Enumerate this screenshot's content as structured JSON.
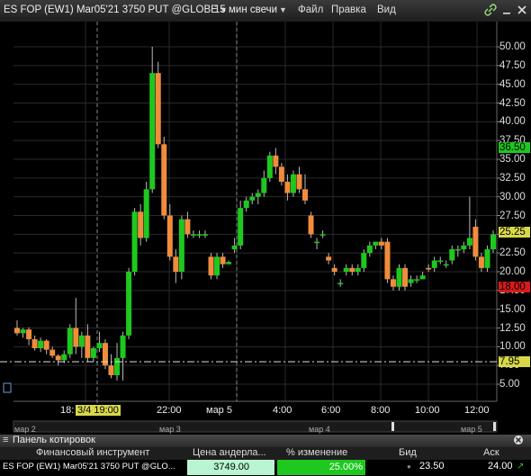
{
  "window": {
    "title": "ES FOP (EW1) Mar05'21 3750 PUT @GLOBE",
    "interval": "15 мин свечи",
    "menu": [
      "Файл",
      "Правка",
      "Вид"
    ]
  },
  "price_axis": [
    "50.00",
    "47.50",
    "45.00",
    "42.50",
    "40.00",
    "37.50",
    "35.00",
    "32.50",
    "30.00",
    "27.50",
    "25.00",
    "22.50",
    "20.00",
    "17.50",
    "15.00",
    "12.50",
    "10.00",
    "7.50",
    "5.00"
  ],
  "price_tags": {
    "ask": "36.50",
    "last": "25.25",
    "bid": "18.00",
    "crosshair": "7.95"
  },
  "time_axis": {
    "labels": [
      "18:",
      "22:00",
      "мар 5",
      "4:00",
      "6:00",
      "8:00",
      "10:00",
      "12:00"
    ],
    "crosshair_time": "3/4 19:00",
    "day_labels": [
      "мар 2",
      "мар 3",
      "мар 4",
      "мар 5"
    ]
  },
  "quote_panel": {
    "title": "Панель котировок",
    "columns": [
      "Финансовый инструмент",
      "Цена андерла...",
      "% изменение",
      "Бид",
      "Аск"
    ],
    "row": {
      "instrument": "ES FOP (EW1) Mar05'21 3750 PUT @GLO...",
      "underlying": "3749.00",
      "change": "25.00%",
      "bid": "23.50",
      "ask": "24.00"
    }
  },
  "colors": {
    "up": "#1ec81e",
    "down": "#f08c3c",
    "bid_tag": "#d81a1a",
    "ask_tag": "#1ec81e",
    "last_tag": "#d8d84a",
    "crosshair_tag": "#d8d84a",
    "change_bg": "#1ec81e",
    "underlying_bg": "#b9f5d2"
  },
  "chart_data": {
    "type": "candlestick",
    "ylim": [
      3.5,
      52.5
    ],
    "candles": [
      {
        "o": 12.5,
        "h": 13.5,
        "l": 11.5,
        "c": 11.8
      },
      {
        "o": 11.8,
        "h": 12.5,
        "l": 11.2,
        "c": 12.3
      },
      {
        "o": 12.3,
        "h": 12.6,
        "l": 10.2,
        "c": 11.0
      },
      {
        "o": 11.0,
        "h": 11.5,
        "l": 9.5,
        "c": 9.8
      },
      {
        "o": 9.8,
        "h": 11.2,
        "l": 9.3,
        "c": 10.8
      },
      {
        "o": 10.8,
        "h": 11.0,
        "l": 9.0,
        "c": 9.6
      },
      {
        "o": 9.6,
        "h": 10.0,
        "l": 8.5,
        "c": 8.8
      },
      {
        "o": 8.8,
        "h": 9.0,
        "l": 7.5,
        "c": 8.2
      },
      {
        "o": 8.2,
        "h": 9.5,
        "l": 7.8,
        "c": 9.0
      },
      {
        "o": 9.0,
        "h": 13.0,
        "l": 8.5,
        "c": 12.5
      },
      {
        "o": 12.5,
        "h": 16.5,
        "l": 9.0,
        "c": 10.0
      },
      {
        "o": 10.0,
        "h": 12.0,
        "l": 8.5,
        "c": 11.5
      },
      {
        "o": 11.5,
        "h": 13.0,
        "l": 8.0,
        "c": 8.5
      },
      {
        "o": 8.5,
        "h": 10.0,
        "l": 8.0,
        "c": 9.8
      },
      {
        "o": 9.8,
        "h": 12.0,
        "l": 9.3,
        "c": 10.5
      },
      {
        "o": 10.5,
        "h": 11.0,
        "l": 7.0,
        "c": 7.5
      },
      {
        "o": 7.5,
        "h": 9.0,
        "l": 5.8,
        "c": 6.2
      },
      {
        "o": 6.2,
        "h": 10.5,
        "l": 5.5,
        "c": 8.5
      },
      {
        "o": 8.5,
        "h": 12.0,
        "l": 5.5,
        "c": 11.5
      },
      {
        "o": 11.5,
        "h": 20.5,
        "l": 11.0,
        "c": 20.0
      },
      {
        "o": 20.0,
        "h": 28.5,
        "l": 19.5,
        "c": 28.0
      },
      {
        "o": 28.0,
        "h": 29.0,
        "l": 23.5,
        "c": 24.5
      },
      {
        "o": 24.5,
        "h": 32.0,
        "l": 24.0,
        "c": 31.0
      },
      {
        "o": 31.0,
        "h": 50.0,
        "l": 30.5,
        "c": 46.5
      },
      {
        "o": 46.5,
        "h": 48.0,
        "l": 36.5,
        "c": 37.0
      },
      {
        "o": 37.0,
        "h": 38.0,
        "l": 27.0,
        "c": 27.5
      },
      {
        "o": 27.5,
        "h": 29.0,
        "l": 21.5,
        "c": 22.0
      },
      {
        "o": 22.0,
        "h": 23.0,
        "l": 18.5,
        "c": 20.0
      },
      {
        "o": 20.0,
        "h": 27.5,
        "l": 19.0,
        "c": 27.0
      },
      {
        "o": 27.0,
        "h": 28.0,
        "l": 24.5,
        "c": 25.0
      },
      {
        "o": 25.0,
        "h": 25.5,
        "l": 24.5,
        "c": 25.0
      },
      {
        "o": 25.0,
        "h": 25.5,
        "l": 24.5,
        "c": 25.0
      },
      {
        "o": 25.0,
        "h": 25.5,
        "l": 24.5,
        "c": 25.0
      },
      {
        "o": 22.0,
        "h": 22.5,
        "l": 19.0,
        "c": 19.5
      },
      {
        "o": 19.5,
        "h": 22.5,
        "l": 19.0,
        "c": 22.0
      },
      {
        "o": 22.0,
        "h": 22.5,
        "l": 20.5,
        "c": 21.0
      },
      {
        "o": 21.0,
        "h": 21.5,
        "l": 21.0,
        "c": 21.3
      },
      {
        "o": 23.0,
        "h": 24.5,
        "l": 22.5,
        "c": 23.5
      },
      {
        "o": 23.5,
        "h": 29.5,
        "l": 23.0,
        "c": 28.5
      },
      {
        "o": 28.5,
        "h": 30.0,
        "l": 28.0,
        "c": 29.5
      },
      {
        "o": 29.5,
        "h": 30.5,
        "l": 29.0,
        "c": 30.0
      },
      {
        "o": 30.0,
        "h": 31.0,
        "l": 29.0,
        "c": 30.5
      },
      {
        "o": 30.5,
        "h": 33.5,
        "l": 30.0,
        "c": 32.5
      },
      {
        "o": 32.5,
        "h": 36.0,
        "l": 32.0,
        "c": 35.5
      },
      {
        "o": 35.5,
        "h": 36.5,
        "l": 33.0,
        "c": 34.0
      },
      {
        "o": 34.0,
        "h": 34.5,
        "l": 31.5,
        "c": 32.0
      },
      {
        "o": 32.0,
        "h": 33.0,
        "l": 29.5,
        "c": 30.5
      },
      {
        "o": 30.5,
        "h": 33.5,
        "l": 30.0,
        "c": 33.0
      },
      {
        "o": 33.0,
        "h": 34.0,
        "l": 30.5,
        "c": 31.0
      },
      {
        "o": 31.0,
        "h": 33.0,
        "l": 29.0,
        "c": 29.5
      },
      {
        "o": 27.5,
        "h": 28.0,
        "l": 24.5,
        "c": 25.0
      },
      {
        "o": 24.0,
        "h": 24.5,
        "l": 23.0,
        "c": 24.0
      },
      {
        "o": 25.0,
        "h": 25.5,
        "l": 24.5,
        "c": 25.0
      },
      {
        "o": 22.0,
        "h": 22.5,
        "l": 21.0,
        "c": 21.5
      },
      {
        "o": 20.5,
        "h": 21.0,
        "l": 19.5,
        "c": 20.0
      },
      {
        "o": 18.5,
        "h": 19.0,
        "l": 18.0,
        "c": 18.5
      },
      {
        "o": 20.0,
        "h": 21.0,
        "l": 19.5,
        "c": 20.5
      },
      {
        "o": 20.5,
        "h": 21.0,
        "l": 19.5,
        "c": 20.0
      },
      {
        "o": 20.0,
        "h": 21.0,
        "l": 19.5,
        "c": 20.5
      },
      {
        "o": 20.5,
        "h": 23.0,
        "l": 20.0,
        "c": 22.5
      },
      {
        "o": 22.5,
        "h": 24.0,
        "l": 22.0,
        "c": 23.5
      },
      {
        "o": 23.5,
        "h": 24.0,
        "l": 23.0,
        "c": 24.0
      },
      {
        "o": 24.0,
        "h": 24.5,
        "l": 23.0,
        "c": 23.5
      },
      {
        "o": 24.0,
        "h": 24.5,
        "l": 18.5,
        "c": 19.0
      },
      {
        "o": 19.0,
        "h": 19.5,
        "l": 17.5,
        "c": 18.0
      },
      {
        "o": 18.0,
        "h": 21.0,
        "l": 17.5,
        "c": 20.5
      },
      {
        "o": 20.5,
        "h": 21.0,
        "l": 17.5,
        "c": 18.0
      },
      {
        "o": 18.5,
        "h": 19.5,
        "l": 18.0,
        "c": 19.0
      },
      {
        "o": 19.0,
        "h": 19.5,
        "l": 18.5,
        "c": 19.0
      },
      {
        "o": 19.0,
        "h": 20.0,
        "l": 19.0,
        "c": 19.5
      },
      {
        "o": 20.5,
        "h": 21.0,
        "l": 20.0,
        "c": 20.3
      },
      {
        "o": 20.5,
        "h": 22.0,
        "l": 20.0,
        "c": 21.5
      },
      {
        "o": 21.5,
        "h": 22.0,
        "l": 21.0,
        "c": 21.5
      },
      {
        "o": 21.0,
        "h": 21.5,
        "l": 20.5,
        "c": 21.0
      },
      {
        "o": 21.5,
        "h": 23.5,
        "l": 21.0,
        "c": 23.0
      },
      {
        "o": 23.0,
        "h": 23.5,
        "l": 22.0,
        "c": 23.0
      },
      {
        "o": 23.0,
        "h": 24.0,
        "l": 22.5,
        "c": 23.5
      },
      {
        "o": 23.5,
        "h": 30.0,
        "l": 23.0,
        "c": 24.5
      },
      {
        "o": 26.0,
        "h": 27.0,
        "l": 21.5,
        "c": 22.0
      },
      {
        "o": 22.0,
        "h": 22.5,
        "l": 20.0,
        "c": 20.5
      },
      {
        "o": 20.5,
        "h": 23.5,
        "l": 20.0,
        "c": 23.0
      },
      {
        "o": 23.0,
        "h": 25.5,
        "l": 22.5,
        "c": 25.0
      }
    ]
  }
}
